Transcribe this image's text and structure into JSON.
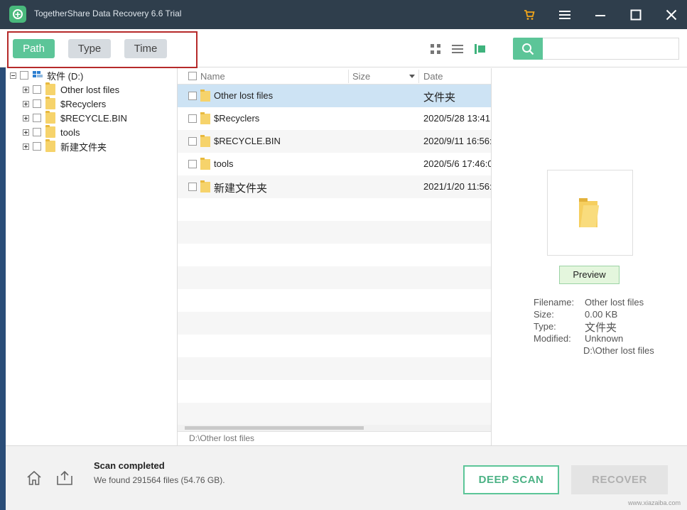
{
  "window": {
    "title": "TogetherShare Data Recovery 6.6 Trial"
  },
  "toolbar": {
    "modes": [
      {
        "label": "Path",
        "active": true
      },
      {
        "label": "Type",
        "active": false
      },
      {
        "label": "Time",
        "active": false
      }
    ],
    "search_placeholder": ""
  },
  "tree": {
    "root": {
      "label": "软件 (D:)"
    },
    "items": [
      {
        "label": "Other lost files"
      },
      {
        "label": "$Recyclers"
      },
      {
        "label": "$RECYCLE.BIN"
      },
      {
        "label": "tools"
      },
      {
        "label": "新建文件夹"
      }
    ]
  },
  "filelist": {
    "columns": {
      "name": "Name",
      "size": "Size",
      "date": "Date"
    },
    "rows": [
      {
        "name": "Other lost files",
        "size": "",
        "date": "文件夹",
        "selected": true
      },
      {
        "name": "$Recyclers",
        "size": "",
        "date": "2020/5/28 13:41:",
        "selected": false
      },
      {
        "name": "$RECYCLE.BIN",
        "size": "",
        "date": "2020/9/11 16:56:",
        "selected": false
      },
      {
        "name": "tools",
        "size": "",
        "date": "2020/5/6 17:46:0",
        "selected": false
      },
      {
        "name": "新建文件夹",
        "size": "",
        "date": "2021/1/20 11:56:",
        "selected": false
      }
    ],
    "current_path": "D:\\Other lost files"
  },
  "preview": {
    "button_label": "Preview",
    "info": {
      "filename_label": "Filename:",
      "filename": "Other lost files",
      "size_label": "Size:",
      "size": "0.00 KB",
      "type_label": "Type:",
      "type": "文件夹",
      "modified_label": "Modified:",
      "modified": "Unknown",
      "path": "D:\\Other lost files"
    }
  },
  "status": {
    "title": "Scan completed",
    "detail": "We found 291564 files (54.76 GB).",
    "deep_scan_label": "DEEP SCAN",
    "recover_label": "RECOVER"
  },
  "colors": {
    "titlebar": "#2f3e4c",
    "accent": "#5cc598",
    "selection": "#cde3f4",
    "highlight_frame": "#b62a2a"
  },
  "watermark": "www.xiazaiba.com"
}
